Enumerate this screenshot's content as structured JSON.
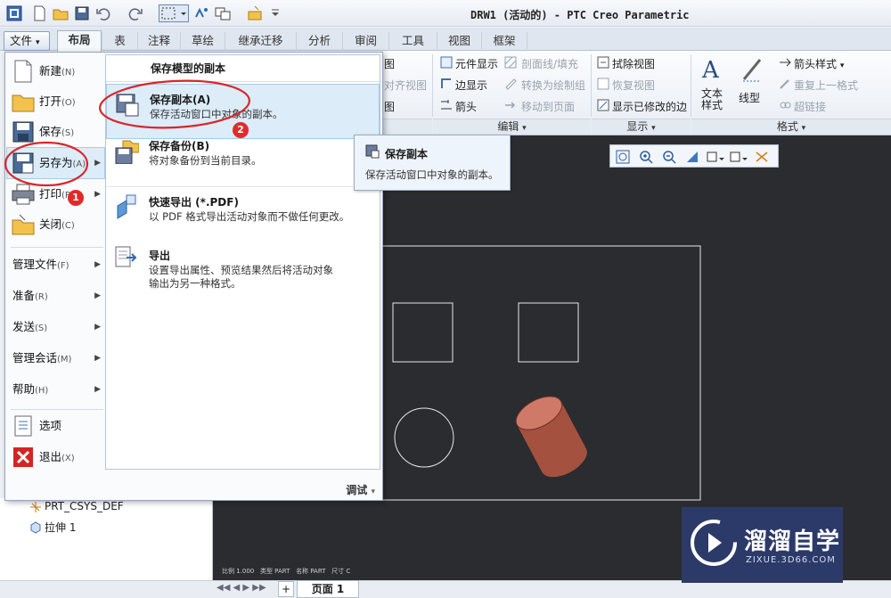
{
  "window": {
    "title": "DRW1 (活动的) - PTC Creo Parametric"
  },
  "tabs": [
    {
      "label": "布局",
      "active": true
    },
    {
      "label": "表"
    },
    {
      "label": "注释"
    },
    {
      "label": "草绘"
    },
    {
      "label": "继承迁移"
    },
    {
      "label": "分析"
    },
    {
      "label": "审阅"
    },
    {
      "label": "工具"
    },
    {
      "label": "视图"
    },
    {
      "label": "框架"
    }
  ],
  "file_menu": {
    "button_label": "文件",
    "items": [
      {
        "label": "新建",
        "accel": "(N)"
      },
      {
        "label": "打开",
        "accel": "(O)"
      },
      {
        "label": "保存",
        "accel": "(S)"
      },
      {
        "label": "另存为",
        "accel": "(A)"
      },
      {
        "label": "打印",
        "accel": "(P)"
      },
      {
        "label": "关闭",
        "accel": "(C)"
      }
    ],
    "sub_items": [
      {
        "label": "管理文件",
        "accel": "(F)"
      },
      {
        "label": "准备",
        "accel": "(R)"
      },
      {
        "label": "发送",
        "accel": "(S)"
      },
      {
        "label": "管理会话",
        "accel": "(M)"
      },
      {
        "label": "帮助",
        "accel": "(H)"
      }
    ],
    "bottom_items": [
      {
        "label": "选项"
      },
      {
        "label": "退出",
        "accel": "(X)"
      }
    ],
    "footer_label": "调试"
  },
  "save_as_submenu": {
    "header": "保存模型的副本",
    "items": [
      {
        "title": "保存副本(A)",
        "desc": "保存活动窗口中对象的副本。"
      },
      {
        "title": "保存备份(B)",
        "desc": "将对象备份到当前目录。"
      },
      {
        "title": "快速导出 (*.PDF)",
        "desc": "以 PDF 格式导出活动对象而不做任何更改。"
      },
      {
        "title": "导出",
        "desc": "设置导出属性、预览结果然后将活动对象输出为另一种格式。"
      }
    ]
  },
  "tooltip": {
    "title": "保存副本",
    "desc": "保存活动窗口中对象的副本。"
  },
  "ribbon": {
    "partial_col": [
      "图",
      "对齐视图",
      "图"
    ],
    "edit_group": {
      "col1": [
        "元件显示",
        "边显示",
        "箭头"
      ],
      "col2": [
        "剖面线/填充",
        "转换为绘制组",
        "移动到页面"
      ],
      "label": "编辑"
    },
    "display_group": {
      "items": [
        "拭除视图",
        "恢复视图",
        "显示已修改的边"
      ],
      "label": "显示"
    },
    "format_group": {
      "big": [
        "文本样式",
        "线型"
      ],
      "items": [
        "箭头样式",
        "重复上一格式",
        "超链接"
      ],
      "label": "格式"
    }
  },
  "annotations": [
    "1",
    "2"
  ],
  "tree": {
    "items": [
      "PRT_CSYS_DEF",
      "拉伸 1"
    ]
  },
  "canvas_footer": {
    "scale": "比例 1.000",
    "type": "类型 PART",
    "name": "名称 PART",
    "size": "尺寸 C"
  },
  "statusbar": {
    "page_label": "页面 1",
    "add": "+"
  },
  "watermark": {
    "title": "溜溜自学",
    "url": "ZIXUE.3D66.COM"
  },
  "colors": {
    "accent": "#d9262a",
    "highlight": "#dcecf9",
    "canvas": "#2a2c2f",
    "model": "#b85f4f"
  }
}
